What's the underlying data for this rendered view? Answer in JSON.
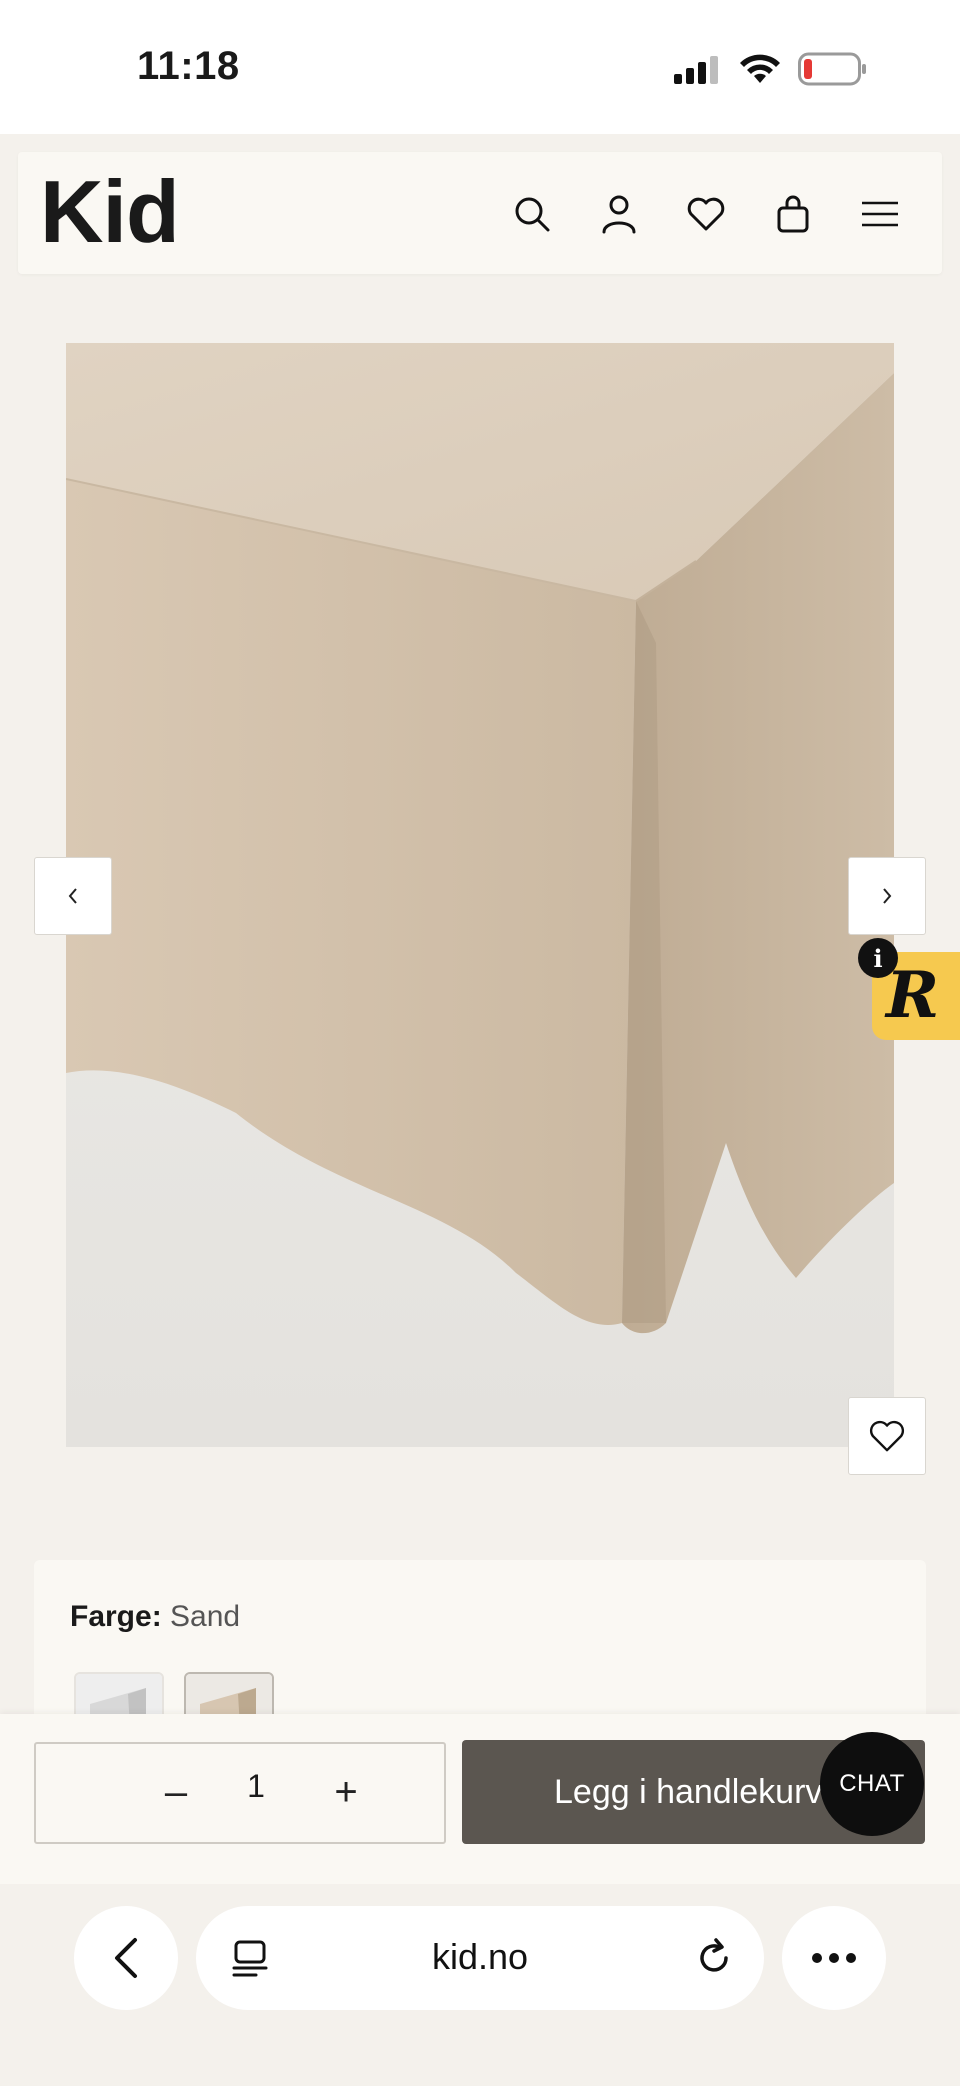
{
  "status_bar": {
    "time": "11:18"
  },
  "header": {
    "logo": "Kid",
    "icons": [
      "search-icon",
      "account-icon",
      "wishlist-icon",
      "cart-icon",
      "menu-icon"
    ]
  },
  "gallery": {
    "prev_icon": "chevron-left-icon",
    "next_icon": "chevron-right-icon",
    "favorite_icon": "heart-icon",
    "badge_letter": "R",
    "badge_info": "i"
  },
  "variant": {
    "color_label": "Farge:",
    "color_value": "Sand",
    "swatches": [
      "Hvit",
      "Sand"
    ],
    "selected_swatch": "Sand"
  },
  "cart": {
    "quantity": "1",
    "minus": "–",
    "plus": "+",
    "add_button": "Legg i handlekurv",
    "chat": "CHAT"
  },
  "browser": {
    "url": "kid.no"
  },
  "colors": {
    "page_bg": "#f4f1ec",
    "header_bg": "#faf8f3",
    "add_button_bg": "#5b5650",
    "badge_bg": "#f6c94f",
    "chat_bg": "#0e0e0e"
  }
}
